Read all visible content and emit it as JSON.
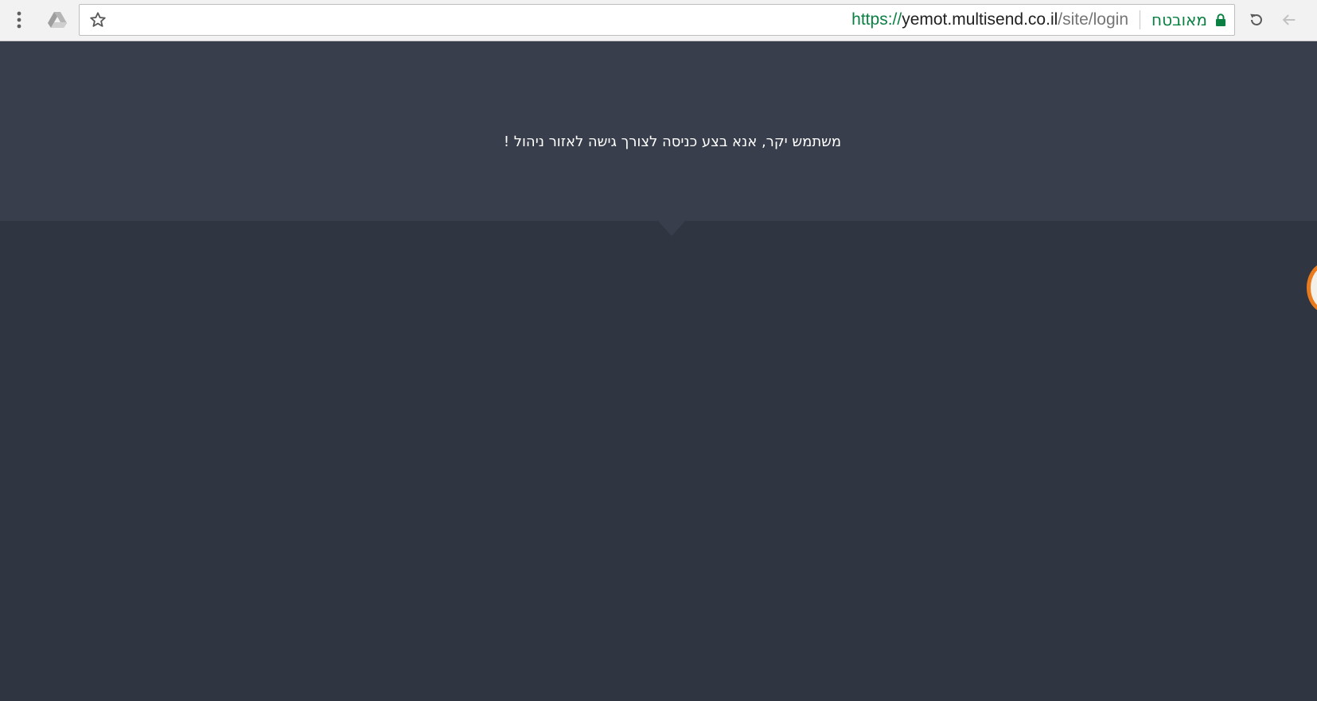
{
  "browser": {
    "address_bar": {
      "secure_label": "מאובטח",
      "url_scheme": "https://",
      "url_host": "yemot.multisend.co.il",
      "url_path": "/site/login"
    },
    "icons": {
      "menu": "vertical-dots-icon",
      "drive": "google-drive-icon",
      "bookmark": "star-icon",
      "lock": "lock-icon",
      "reload": "reload-icon",
      "back": "back-arrow-icon"
    },
    "colors": {
      "secure_green": "#0b8043"
    }
  },
  "page": {
    "welcome_message": "משתמש יקר, אנא בצע כניסה לצורך גישה לאזור ניהול !",
    "colors": {
      "header_band": "#383e4b",
      "body_background": "#2f3541",
      "widget_accent": "#e87b1e"
    }
  }
}
